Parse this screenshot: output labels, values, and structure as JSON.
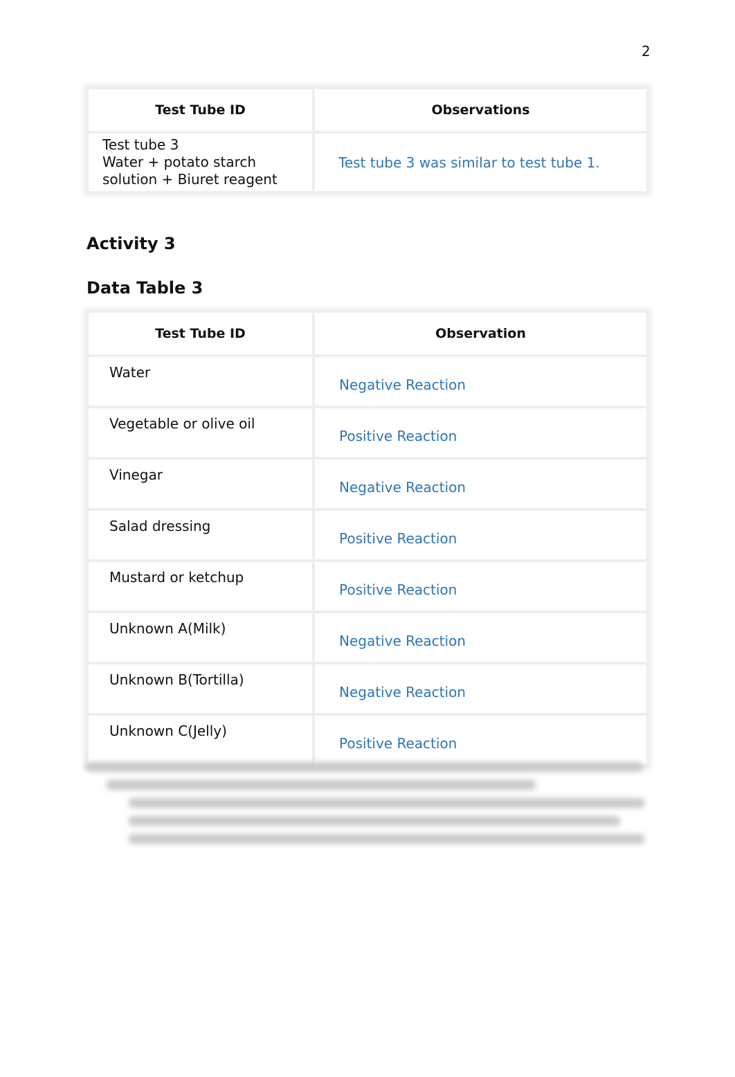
{
  "page_number": "2",
  "table_top": {
    "headers": [
      "Test Tube ID",
      "Observations"
    ],
    "rows": [
      {
        "id_lines": [
          "Test tube 3",
          "Water + potato starch",
          "solution + Biuret reagent"
        ],
        "observation": "Test tube 3 was similar to test tube 1."
      }
    ]
  },
  "activity_heading": "Activity 3",
  "table3_heading": "Data Table 3",
  "table3": {
    "headers": [
      "Test Tube ID",
      "Observation"
    ],
    "rows": [
      {
        "id": "Water",
        "observation": "Negative Reaction"
      },
      {
        "id": "Vegetable or olive oil",
        "observation": "Positive Reaction"
      },
      {
        "id": "Vinegar",
        "observation": "Negative Reaction"
      },
      {
        "id": "Salad dressing",
        "observation": "Positive Reaction"
      },
      {
        "id": "Mustard or ketchup",
        "observation": "Positive Reaction"
      },
      {
        "id": "Unknown A(Milk)",
        "observation": "Negative Reaction"
      },
      {
        "id": "Unknown B(Tortilla)",
        "observation": "Negative Reaction"
      },
      {
        "id": "Unknown C(Jelly)",
        "observation": "Positive Reaction"
      }
    ]
  },
  "colors": {
    "answer_text": "#2e75b6"
  }
}
